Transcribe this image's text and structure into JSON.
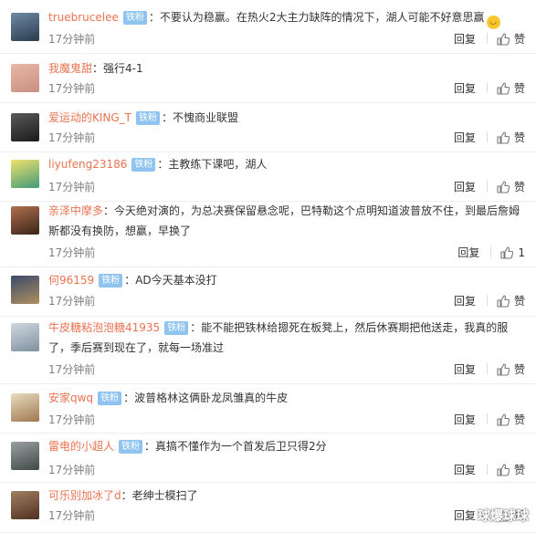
{
  "reply_label": "回复",
  "like_label": "赞",
  "badge_label": "铁粉",
  "watermark": "球爆球球",
  "comments": [
    {
      "username": "truebrucelee",
      "badge": true,
      "text": "：不要认为稳赢。在热火2大主力缺阵的情况下，湖人可能不好意思赢",
      "emoji": "grinning-sweat-emoji",
      "time": "17分钟前",
      "likes": "",
      "avatar_colors": [
        "#6f8ba6",
        "#2a3b4c"
      ]
    },
    {
      "username": "我魔鬼甜",
      "badge": false,
      "text": "：强行4-1",
      "time": "17分钟前",
      "likes": "",
      "avatar_colors": [
        "#e8b8a8",
        "#c98f7f"
      ]
    },
    {
      "username": "爱运动的KING_T",
      "badge": true,
      "text": "：不愧商业联盟",
      "time": "17分钟前",
      "likes": "",
      "avatar_colors": [
        "#5a5a5a",
        "#1a1a1a"
      ]
    },
    {
      "username": "liyufeng23186",
      "badge": true,
      "text": "：主教练下课吧，湖人",
      "time": "17分钟前",
      "likes": "",
      "avatar_colors": [
        "#f2e26a",
        "#3f9a7a"
      ]
    },
    {
      "username": "亲泽中摩多",
      "badge": false,
      "text": "：今天绝对演的，为总决赛保留悬念呢，巴特勒这个点明知道波普放不住，到最后詹姆斯都没有换防，想赢，早换了",
      "time": "17分钟前",
      "likes": "1",
      "avatar_colors": [
        "#b07050",
        "#3a2418"
      ]
    },
    {
      "username": "何96159",
      "badge": true,
      "text": "：AD今天基本没打",
      "time": "17分钟前",
      "likes": "",
      "avatar_colors": [
        "#3a4a6a",
        "#b09060"
      ]
    },
    {
      "username": "牛皮糖粘泡泡糖41935",
      "badge": true,
      "text": "：能不能把铁林给摁死在板凳上，然后休赛期把他送走，我真的服了，季后赛到现在了，就每一场准过",
      "time": "17分钟前",
      "likes": "",
      "avatar_colors": [
        "#cfd8e0",
        "#8090a0"
      ]
    },
    {
      "username": "安家qwq",
      "badge": true,
      "text": "：波普格林这俩卧龙凤雏真的牛皮",
      "time": "17分钟前",
      "likes": "",
      "avatar_colors": [
        "#e8dcc0",
        "#a07850"
      ]
    },
    {
      "username": "雷电的小超人",
      "badge": true,
      "text": "：真搞不懂作为一个首发后卫只得2分",
      "time": "17分钟前",
      "likes": "",
      "avatar_colors": [
        "#9aa0a0",
        "#404848"
      ]
    },
    {
      "username": "可乐别加冰了d",
      "badge": false,
      "text": "：老绅士模扫了",
      "time": "17分钟前",
      "likes": "",
      "avatar_colors": [
        "#a08060",
        "#503020"
      ]
    }
  ]
}
